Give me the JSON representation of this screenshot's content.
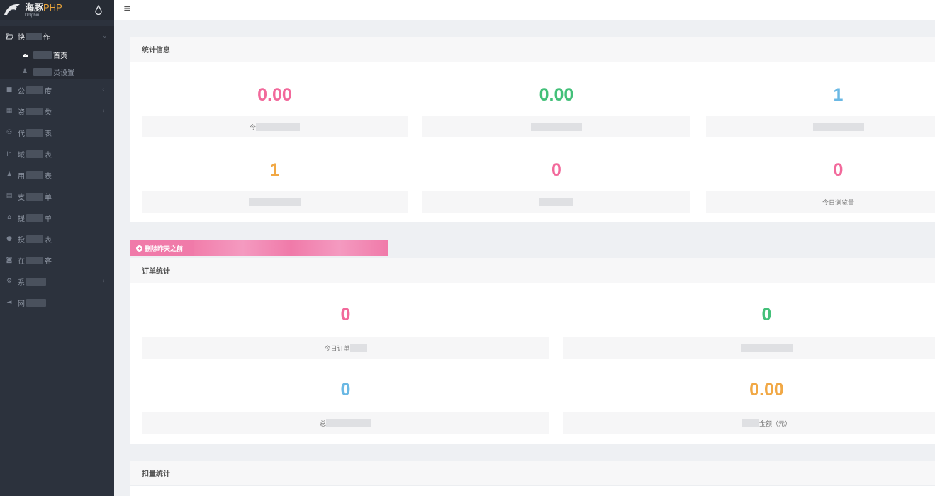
{
  "brand": {
    "title_cn": "海豚",
    "title_php": "PHP",
    "subtitle": "Dolphin"
  },
  "sidebar": {
    "group": {
      "label": "快捷操作",
      "label_visible": "快",
      "label_tail": "作",
      "items": [
        {
          "label": "首页",
          "icon": "dashboard-icon",
          "active": true
        },
        {
          "label": "员设置",
          "icon": "user-icon",
          "active": false
        }
      ]
    },
    "items": [
      {
        "label_head": "公",
        "label_tail": "度",
        "icon": "video-icon",
        "has_arrow": true
      },
      {
        "label_head": "资",
        "label_tail": "类",
        "icon": "grid-icon",
        "has_arrow": true
      },
      {
        "label_head": "代",
        "label_tail": "表",
        "icon": "group-icon",
        "has_arrow": false
      },
      {
        "label_head": "域",
        "label_tail": "表",
        "icon": "link-icon",
        "has_arrow": false
      },
      {
        "label_head": "用",
        "label_tail": "表",
        "icon": "user-icon",
        "has_arrow": false
      },
      {
        "label_head": "支",
        "label_tail": "单",
        "icon": "card-icon",
        "has_arrow": false
      },
      {
        "label_head": "提",
        "label_tail": "单",
        "icon": "bank-icon",
        "has_arrow": false
      },
      {
        "label_head": "投",
        "label_tail": "表",
        "icon": "info-icon",
        "has_arrow": false
      },
      {
        "label_head": "在",
        "label_tail": "客",
        "icon": "chat-icon",
        "has_arrow": false
      },
      {
        "label_head": "系",
        "label_tail": "",
        "icon": "gear-icon",
        "has_arrow": true
      },
      {
        "label_head": "网",
        "label_tail": "",
        "icon": "megaphone-icon",
        "has_arrow": false
      }
    ]
  },
  "topbar": {
    "menu_icon": "hamburger-icon",
    "menu_glyph": "≡"
  },
  "stats_panel": {
    "title": "统计信息",
    "stats": [
      {
        "value": "0.00",
        "label": "今",
        "color": "#f2699b"
      },
      {
        "value": "0.00",
        "label": "",
        "color": "#43c079"
      },
      {
        "value": "1",
        "label": "",
        "color": "#6ab8e4"
      },
      {
        "value": "1",
        "label": "",
        "color": "#f1a845"
      },
      {
        "value": "0",
        "label": "",
        "color": "#f2699b"
      },
      {
        "value": "0",
        "label": "今日浏览量",
        "color": "#f2699b"
      }
    ]
  },
  "action_button": {
    "label": "删除昨天之前",
    "icon": "plus-circle-icon"
  },
  "order_panel": {
    "title": "订单统计",
    "stats": [
      {
        "value": "0",
        "label": "今日订单",
        "color": "#f2699b"
      },
      {
        "value": "0",
        "label": "",
        "color": "#43c079"
      },
      {
        "value": "0",
        "label": "总",
        "color": "#6ab8e4"
      },
      {
        "value": "0.00",
        "label": "金额（元）",
        "color": "#f1a845"
      }
    ]
  },
  "deduct_panel": {
    "title": "扣量统计"
  }
}
